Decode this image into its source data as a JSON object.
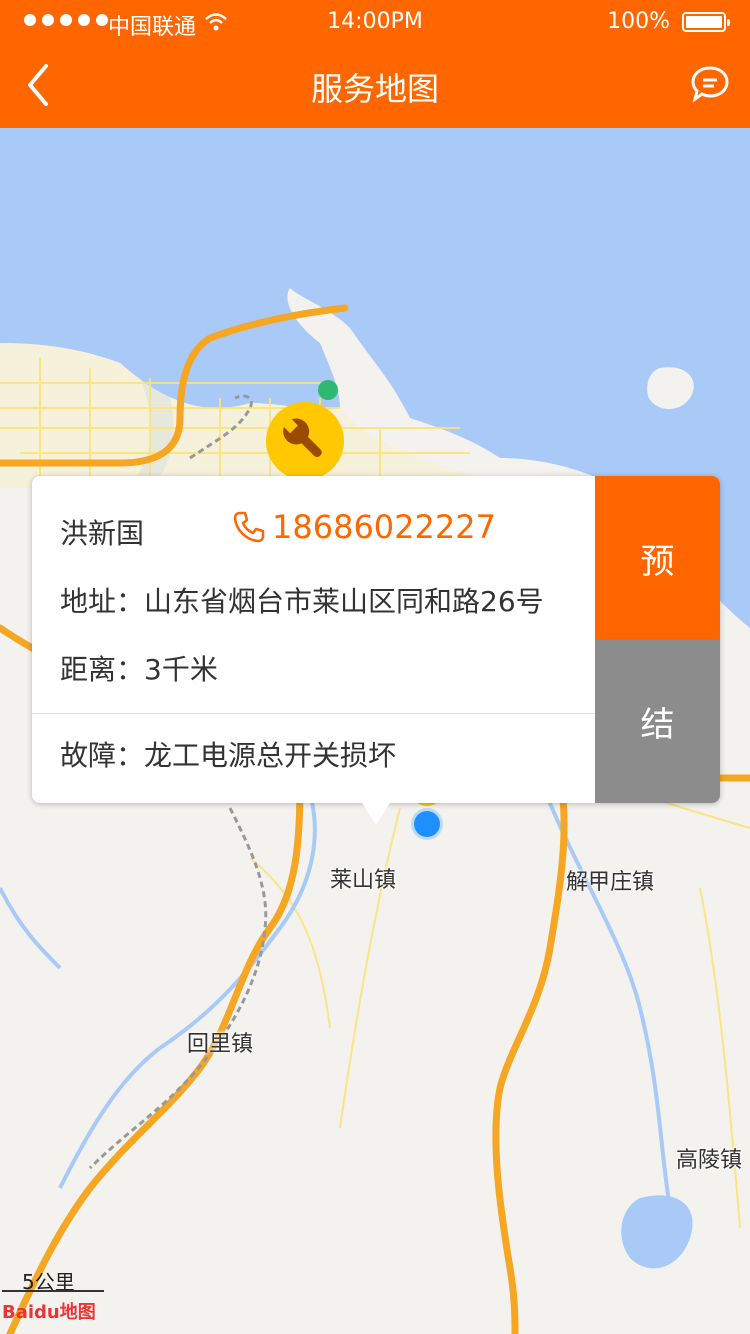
{
  "status_bar": {
    "carrier": "中国联通",
    "time": "14:00PM",
    "battery": "100%"
  },
  "nav": {
    "title": "服务地图",
    "back_icon": "chevron-left-icon",
    "message_icon": "chat-bubble-icon"
  },
  "map": {
    "labels": [
      "莱山镇",
      "解甲庄镇",
      "回里镇",
      "高陵镇"
    ],
    "scale": "5公里",
    "logo_text": "Baidu地图"
  },
  "card": {
    "name": "洪新国",
    "phone": "18686022227",
    "address_label": "地址：",
    "address": "山东省烟台市莱山区同和路26号",
    "distance_label": "距离：",
    "distance": "3千米",
    "fault_label": "故障：",
    "fault": "龙工电源总开关损坏",
    "reserve_button": "预",
    "settle_button": "结"
  },
  "colors": {
    "brand": "#ff6600",
    "secondary_button": "#8c8c8c",
    "water": "#a9c9f7",
    "land": "#f3f2ef"
  }
}
